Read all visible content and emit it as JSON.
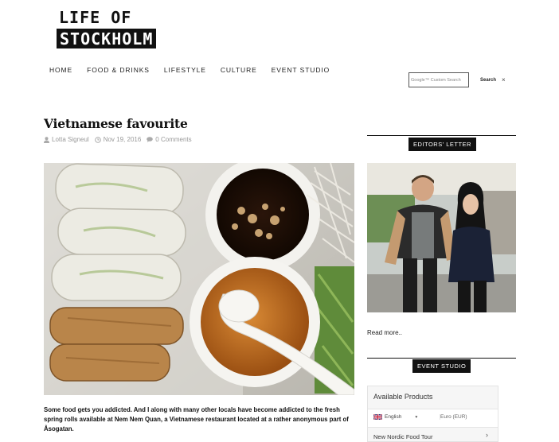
{
  "site": {
    "logo_line1": "LIFE OF",
    "logo_line2": "STOCKHOLM"
  },
  "nav": {
    "items": [
      "HOME",
      "FOOD & DRINKS",
      "LIFESTYLE",
      "CULTURE",
      "EVENT STUDIO"
    ]
  },
  "search": {
    "placeholder": "Google™ Custom Search",
    "button_label": "Search",
    "clear_label": "×"
  },
  "article": {
    "title": "Vietnamese favourite",
    "author": "Lotta Signeul",
    "date": "Nov 19, 2016",
    "comments": "0 Comments",
    "body": "Some food gets you addicted. And I along with many other locals have become addicted to the fresh spring rolls available at Nem Nem Quan, a Vietnamese restaurant located at a rather anonymous part of Åsogatan."
  },
  "sidebar": {
    "editors_label": "EDITORS' LETTER",
    "read_more": "Read more..",
    "event_label": "EVENT STUDIO",
    "products_title": "Available Products",
    "language": "English",
    "currency": "Euro (EUR)",
    "product_name": "New Nordic Food Tour"
  },
  "colors": {
    "black": "#111111",
    "meta_grey": "#999999"
  }
}
